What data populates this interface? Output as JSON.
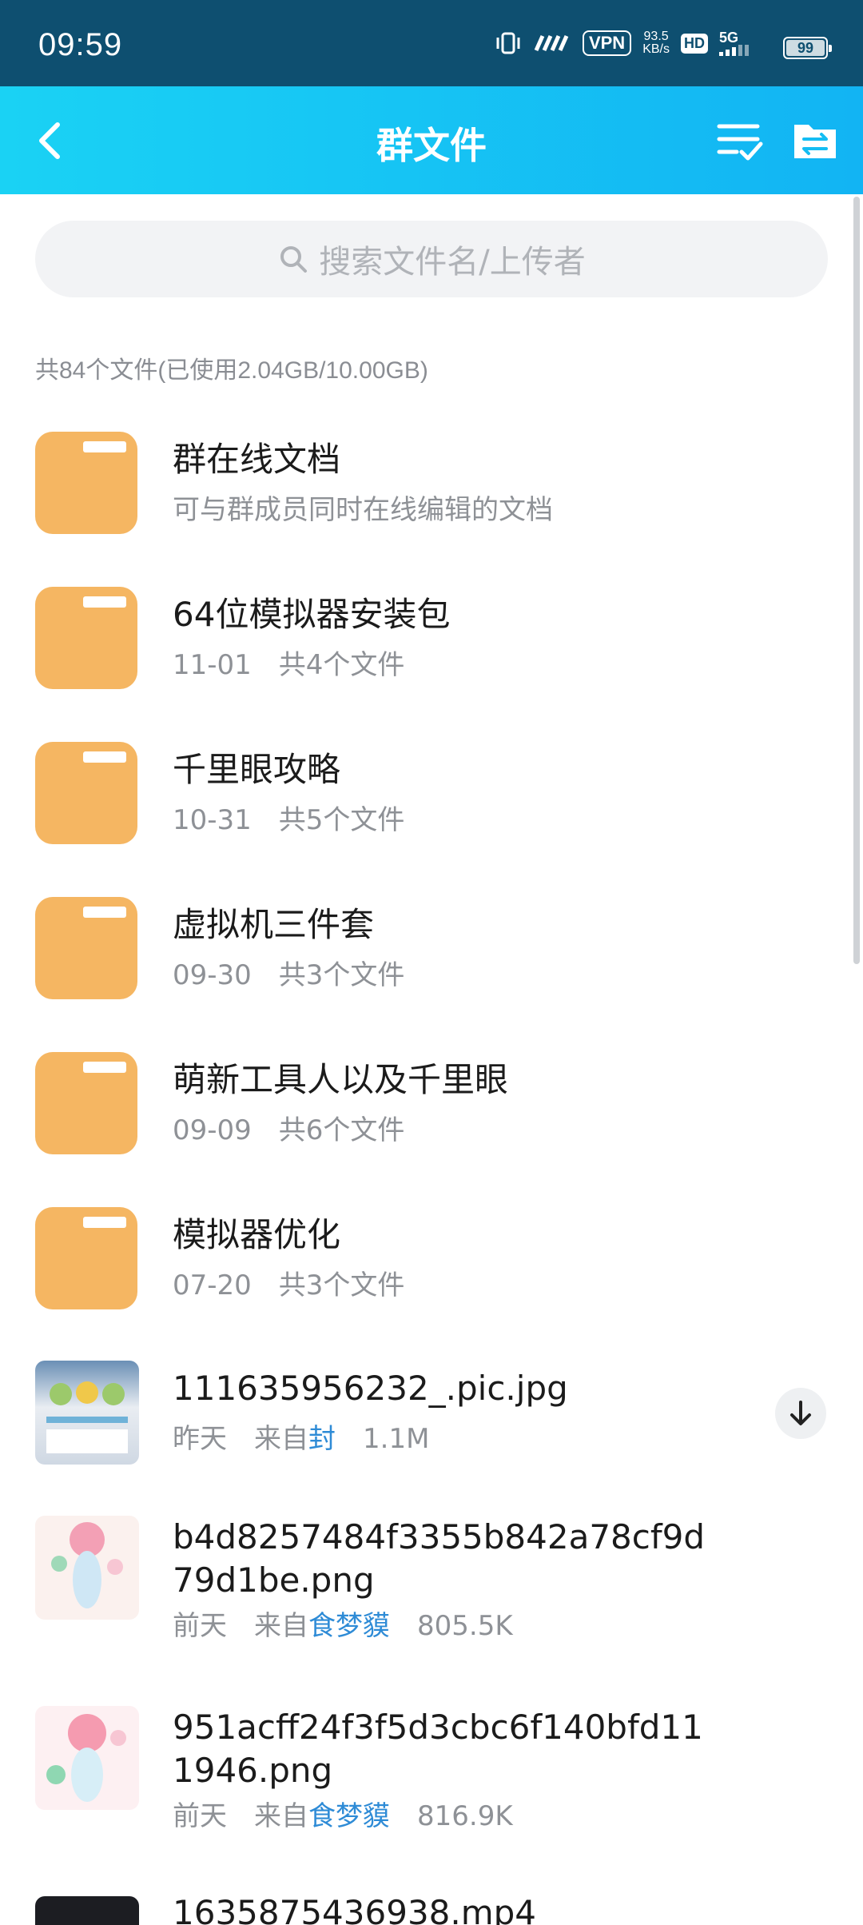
{
  "status": {
    "time": "09:59",
    "net_speed_value": "93.5",
    "net_speed_unit": "KB/s",
    "vpn": "VPN",
    "hd": "HD",
    "network": "5G",
    "battery": "99"
  },
  "header": {
    "title": "群文件"
  },
  "search": {
    "placeholder": "搜索文件名/上传者"
  },
  "summary": "共84个文件(已使用2.04GB/10.00GB)",
  "folders": [
    {
      "name": "群在线文档",
      "desc": "可与群成员同时在线编辑的文档"
    },
    {
      "name": "64位模拟器安装包",
      "date": "11-01",
      "count": "共4个文件"
    },
    {
      "name": "千里眼攻略",
      "date": "10-31",
      "count": "共5个文件"
    },
    {
      "name": "虚拟机三件套",
      "date": "09-30",
      "count": "共3个文件"
    },
    {
      "name": "萌新工具人以及千里眼",
      "date": "09-09",
      "count": "共6个文件"
    },
    {
      "name": "模拟器优化",
      "date": "07-20",
      "count": "共3个文件"
    }
  ],
  "files": [
    {
      "name": "111635956232_.pic.jpg",
      "date": "昨天",
      "from_label": "来自",
      "uploader": "封",
      "size": "1.1M"
    },
    {
      "name_line1": "b4d8257484f3355b842a78cf9d",
      "name_line2": "79d1be.png",
      "date": "前天",
      "from_label": "来自",
      "uploader": "食梦貘",
      "size": "805.5K"
    },
    {
      "name_line1": "951acff24f3f5d3cbc6f140bfd11",
      "name_line2": "1946.png",
      "date": "前天",
      "from_label": "来自",
      "uploader": "食梦貘",
      "size": "816.9K"
    },
    {
      "name": "1635875436938.mp4"
    }
  ],
  "colors": {
    "appbar_start": "#1ad2f4",
    "appbar_end": "#12b4f3",
    "folder": "#f5b662",
    "uploader_link": "#2e8bd6"
  }
}
